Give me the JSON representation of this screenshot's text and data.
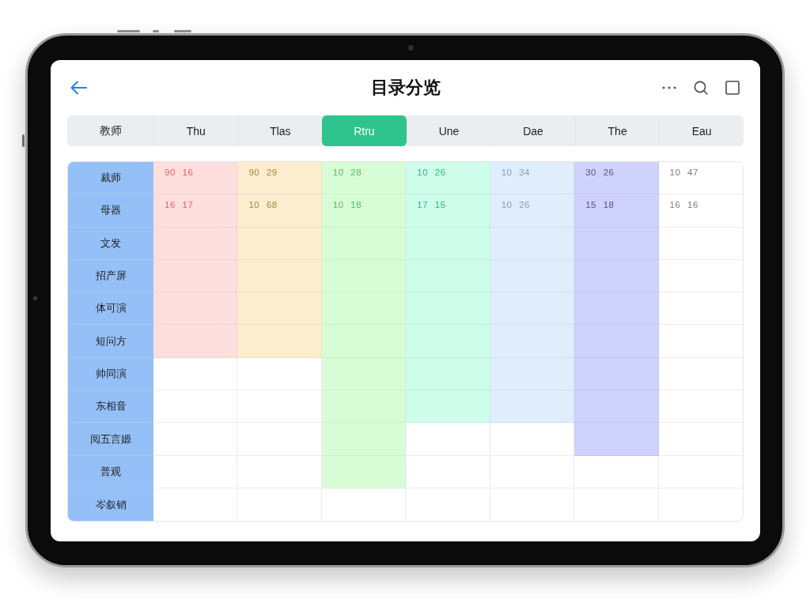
{
  "header": {
    "title": "目录分览"
  },
  "tabs": [
    {
      "label": "教师",
      "selected": false
    },
    {
      "label": "Thu",
      "selected": false
    },
    {
      "label": "Tlas",
      "selected": false
    },
    {
      "label": "Rtru",
      "selected": true
    },
    {
      "label": "Une",
      "selected": false
    },
    {
      "label": "Dae",
      "selected": false
    },
    {
      "label": "The",
      "selected": false
    },
    {
      "label": "Eau",
      "selected": false
    }
  ],
  "table": {
    "columns": [
      {
        "color": "#e0655e"
      },
      {
        "color": "#a8843c"
      },
      {
        "color": "#5cb85c"
      },
      {
        "color": "#2fb27f"
      },
      {
        "color": "#7f9fc4"
      },
      {
        "color": "#50558f"
      },
      {
        "color": "#7a7a7a"
      }
    ],
    "rows": [
      {
        "label": "裁师",
        "cells": [
          {
            "text": "90 16",
            "shaded": true
          },
          {
            "text": "90 29",
            "shaded": true
          },
          {
            "text": "10 28",
            "shaded": true
          },
          {
            "text": "10 26",
            "shaded": true
          },
          {
            "text": "10 34",
            "shaded": true
          },
          {
            "text": "30 26",
            "shaded": true
          },
          {
            "text": "10 47",
            "shaded": false
          }
        ]
      },
      {
        "label": "母器",
        "cells": [
          {
            "text": "16 17",
            "shaded": true
          },
          {
            "text": "10 68",
            "shaded": true
          },
          {
            "text": "10 18",
            "shaded": true
          },
          {
            "text": "17 15",
            "shaded": true
          },
          {
            "text": "10 26",
            "shaded": true
          },
          {
            "text": "15 18",
            "shaded": true
          },
          {
            "text": "16 16",
            "shaded": false
          }
        ]
      },
      {
        "label": "文发",
        "cells": [
          {
            "shaded": true
          },
          {
            "shaded": true
          },
          {
            "shaded": true
          },
          {
            "shaded": true
          },
          {
            "shaded": true
          },
          {
            "shaded": true
          },
          {
            "shaded": false
          }
        ]
      },
      {
        "label": "招产屏",
        "cells": [
          {
            "shaded": true
          },
          {
            "shaded": true
          },
          {
            "shaded": true
          },
          {
            "shaded": true
          },
          {
            "shaded": true
          },
          {
            "shaded": true
          },
          {
            "shaded": false
          }
        ]
      },
      {
        "label": "体可演",
        "cells": [
          {
            "shaded": true
          },
          {
            "shaded": true
          },
          {
            "shaded": true
          },
          {
            "shaded": true
          },
          {
            "shaded": true
          },
          {
            "shaded": true
          },
          {
            "shaded": false
          }
        ]
      },
      {
        "label": "短问方",
        "cells": [
          {
            "shaded": true
          },
          {
            "shaded": true
          },
          {
            "shaded": true
          },
          {
            "shaded": true
          },
          {
            "shaded": true
          },
          {
            "shaded": true
          },
          {
            "shaded": false
          }
        ]
      },
      {
        "label": "帅同演",
        "cells": [
          {
            "shaded": false
          },
          {
            "shaded": false
          },
          {
            "shaded": true
          },
          {
            "shaded": true
          },
          {
            "shaded": true
          },
          {
            "shaded": true
          },
          {
            "shaded": false
          }
        ]
      },
      {
        "label": "东相音",
        "cells": [
          {
            "shaded": false
          },
          {
            "shaded": false
          },
          {
            "shaded": true
          },
          {
            "shaded": true
          },
          {
            "shaded": true
          },
          {
            "shaded": true
          },
          {
            "shaded": false
          }
        ]
      },
      {
        "label": "阅五言嫄",
        "cells": [
          {
            "shaded": false
          },
          {
            "shaded": false
          },
          {
            "shaded": true
          },
          {
            "shaded": false
          },
          {
            "shaded": false
          },
          {
            "shaded": true
          },
          {
            "shaded": false
          }
        ]
      },
      {
        "label": "普观",
        "cells": [
          {
            "shaded": false
          },
          {
            "shaded": false
          },
          {
            "shaded": true
          },
          {
            "shaded": false
          },
          {
            "shaded": false
          },
          {
            "shaded": false
          },
          {
            "shaded": false
          }
        ]
      },
      {
        "label": "岑叙销",
        "cells": [
          {
            "shaded": false
          },
          {
            "shaded": false
          },
          {
            "shaded": false
          },
          {
            "shaded": false
          },
          {
            "shaded": false
          },
          {
            "shaded": false
          },
          {
            "shaded": false
          }
        ]
      }
    ]
  }
}
